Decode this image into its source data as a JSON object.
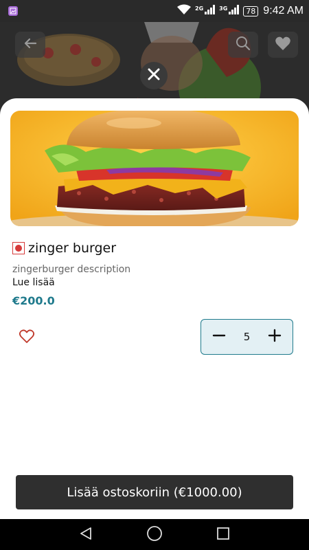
{
  "status_bar": {
    "net_a": "2G",
    "net_b": "3G",
    "battery": "78",
    "time": "9:42 AM"
  },
  "icons": {
    "back": "arrow-left-icon",
    "search": "search-icon",
    "favorite": "heart-icon",
    "close": "close-icon"
  },
  "item": {
    "title": "zinger burger",
    "description": "zingerburger description",
    "read_more": "Lue lisää",
    "price": "€200.0",
    "quantity": "5",
    "veg_indicator_color": "#d63a3a"
  },
  "cart": {
    "button_label": "Lisää ostoskoriin (€1000.00)"
  },
  "colors": {
    "accent": "#1f7a8c",
    "button_dark": "#2f2f2f"
  }
}
